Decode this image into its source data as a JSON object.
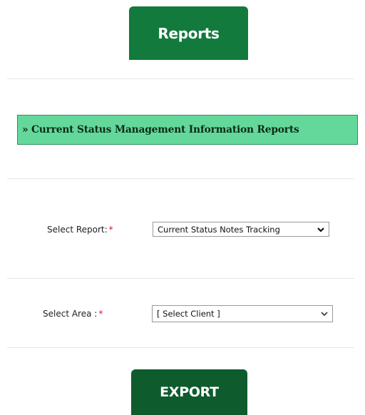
{
  "header": {
    "reports_label": "Reports"
  },
  "section": {
    "title": "» Current Status Management Information Reports"
  },
  "form": {
    "report": {
      "label": "Select Report:",
      "required": "*",
      "value": "Current Status Notes Tracking"
    },
    "area": {
      "label": "Select Area :",
      "required": "*",
      "value": "[ Select Client ]"
    }
  },
  "actions": {
    "export_label": "EXPORT"
  },
  "colors": {
    "tab_green": "#127a3c",
    "banner_green": "#63d89a",
    "export_green": "#0e5b2d",
    "required_red": "#e0102a"
  },
  "icons": {
    "dropdown": "chevron-down-icon"
  }
}
